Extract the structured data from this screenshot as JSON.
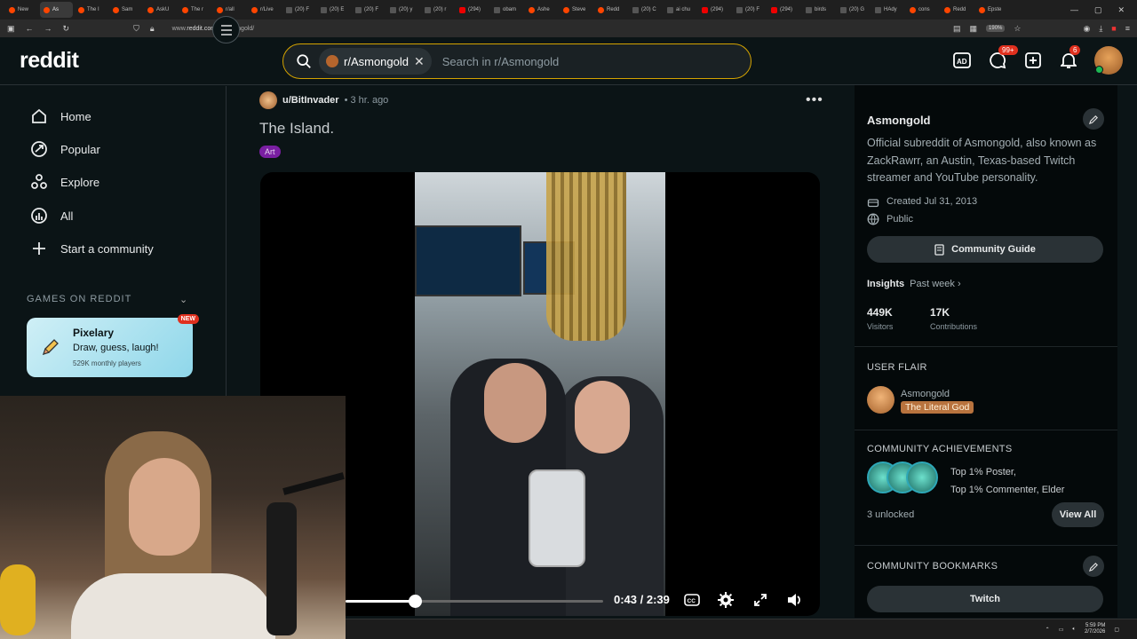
{
  "browser": {
    "tabs": [
      {
        "label": "New",
        "fav": "reddit"
      },
      {
        "label": "As",
        "fav": "reddit",
        "active": true
      },
      {
        "label": "The I",
        "fav": "reddit"
      },
      {
        "label": "Sam",
        "fav": "reddit"
      },
      {
        "label": "AskU",
        "fav": "reddit"
      },
      {
        "label": "The r",
        "fav": "reddit"
      },
      {
        "label": "r/all",
        "fav": "reddit"
      },
      {
        "label": "r/Live",
        "fav": "reddit"
      },
      {
        "label": "(20) F",
        "fav": "x"
      },
      {
        "label": "(20) E",
        "fav": "x"
      },
      {
        "label": "(20) F",
        "fav": "x"
      },
      {
        "label": "(20) y",
        "fav": "x"
      },
      {
        "label": "(20) r",
        "fav": "x"
      },
      {
        "label": "(294)",
        "fav": "yt"
      },
      {
        "label": "obam",
        "fav": "x"
      },
      {
        "label": "Ashe",
        "fav": "reddit"
      },
      {
        "label": "Steve",
        "fav": "reddit"
      },
      {
        "label": "Redd",
        "fav": "reddit"
      },
      {
        "label": "(20) C",
        "fav": "x"
      },
      {
        "label": "ai chu",
        "fav": "x"
      },
      {
        "label": "(294)",
        "fav": "yt"
      },
      {
        "label": "(20) F",
        "fav": "x"
      },
      {
        "label": "(294)",
        "fav": "yt"
      },
      {
        "label": "birds",
        "fav": "x"
      },
      {
        "label": "(20) G",
        "fav": "x"
      },
      {
        "label": "HAdy",
        "fav": "x"
      },
      {
        "label": "cons",
        "fav": "reddit"
      },
      {
        "label": "Redd",
        "fav": "reddit"
      },
      {
        "label": "Epste",
        "fav": "reddit"
      }
    ],
    "url_prefix": "www.",
    "url_domain": "reddit.com",
    "url_path": "/r/Asmongold/",
    "zoom": "190%"
  },
  "header": {
    "logo": "reddit",
    "search_chip": "r/Asmongold",
    "search_placeholder": "Search in r/Asmongold",
    "chat_badge": "99+",
    "notif_badge": "6"
  },
  "left_nav": {
    "items": [
      {
        "label": "Home",
        "icon": "home-icon"
      },
      {
        "label": "Popular",
        "icon": "popular-icon"
      },
      {
        "label": "Explore",
        "icon": "explore-icon"
      },
      {
        "label": "All",
        "icon": "all-icon"
      },
      {
        "label": "Start a community",
        "icon": "plus-icon"
      }
    ],
    "games_title": "GAMES ON REDDIT",
    "game_card": {
      "title": "Pixelary",
      "subtitle": "Draw, guess, laugh!",
      "meta": "529K monthly players",
      "badge": "NEW"
    }
  },
  "post": {
    "user": "u/BitInvader",
    "time": "• 3 hr. ago",
    "title": "The Island.",
    "flair": "Art",
    "video": {
      "current": "0:43",
      "duration": "2:39",
      "progress": 0.27
    }
  },
  "community": {
    "name": "Asmongold",
    "description": "Official subreddit of Asmongold, also known as ZackRawrr, an Austin, Texas-based Twitch streamer and YouTube personality.",
    "created": "Created Jul 31, 2013",
    "visibility": "Public",
    "guide_label": "Community Guide",
    "insights_label": "Insights",
    "insights_period": "Past week ›",
    "visitors_value": "449K",
    "visitors_label": "Visitors",
    "contrib_value": "17K",
    "contrib_label": "Contributions",
    "user_flair_title": "USER FLAIR",
    "flair_name": "Asmongold",
    "flair_tag": "The Literal God",
    "achievements_title": "COMMUNITY ACHIEVEMENTS",
    "achievements_line1": "Top 1% Poster,",
    "achievements_line2": "Top 1% Commenter, Elder",
    "unlocked": "3 unlocked",
    "view_all": "View All",
    "bookmarks_title": "COMMUNITY BOOKMARKS",
    "bookmark_twitch": "Twitch"
  },
  "taskbar": {
    "time": "5:59 PM",
    "date": "2/7/2026"
  }
}
